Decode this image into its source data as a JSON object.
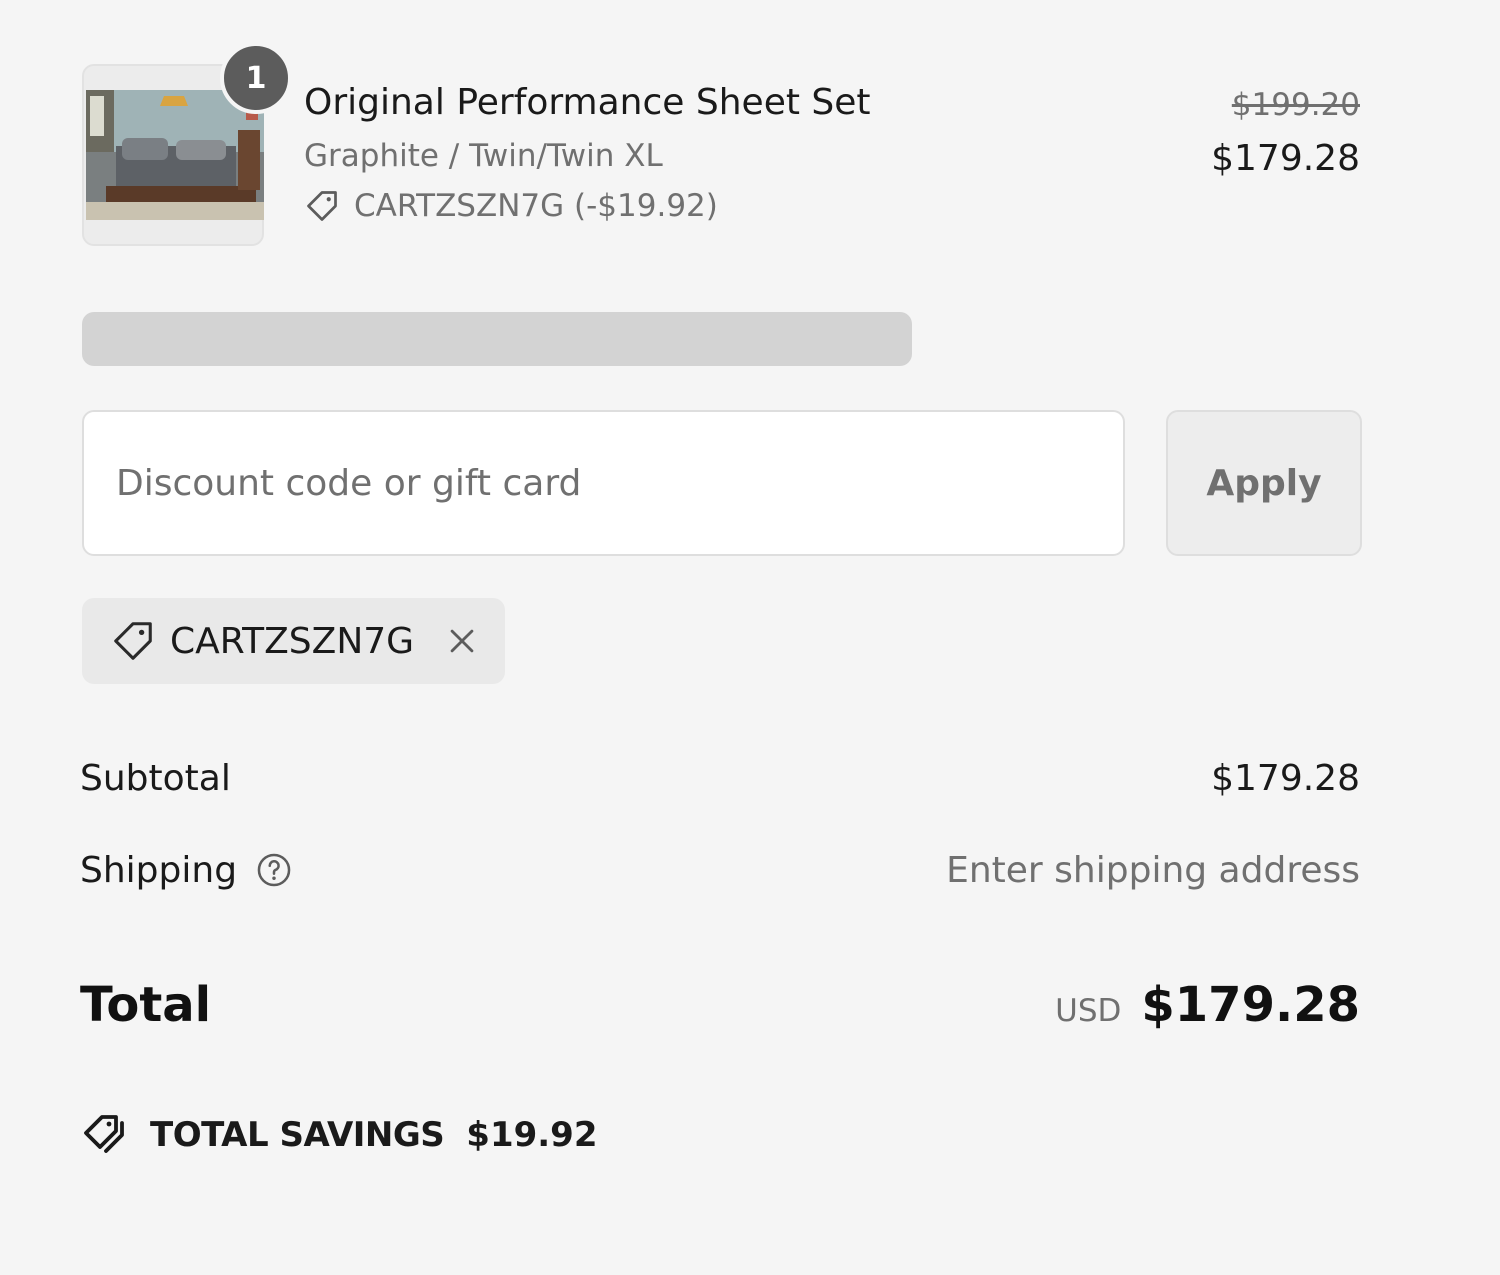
{
  "product": {
    "name": "Original Performance Sheet Set",
    "variant": "Graphite / Twin/Twin XL",
    "discount_applied": "CARTZSZN7G (-$19.92)",
    "quantity": "1",
    "price_original": "$199.20",
    "price_current": "$179.28",
    "image_icon": "bedroom-photo"
  },
  "discount_form": {
    "placeholder": "Discount code or gift card",
    "value": "",
    "apply_label": "Apply"
  },
  "applied_code": {
    "code": "CARTZSZN7G"
  },
  "summary": {
    "subtotal_label": "Subtotal",
    "subtotal_value": "$179.28",
    "shipping_label": "Shipping",
    "shipping_value": "Enter shipping address",
    "total_label": "Total",
    "currency": "USD",
    "total_value": "$179.28"
  },
  "savings": {
    "label": "TOTAL SAVINGS",
    "amount": "$19.92"
  },
  "colors": {
    "background": "#f5f5f5",
    "muted_text": "#707070",
    "badge": "#5c5c5c",
    "skeleton": "#d3d3d3"
  }
}
